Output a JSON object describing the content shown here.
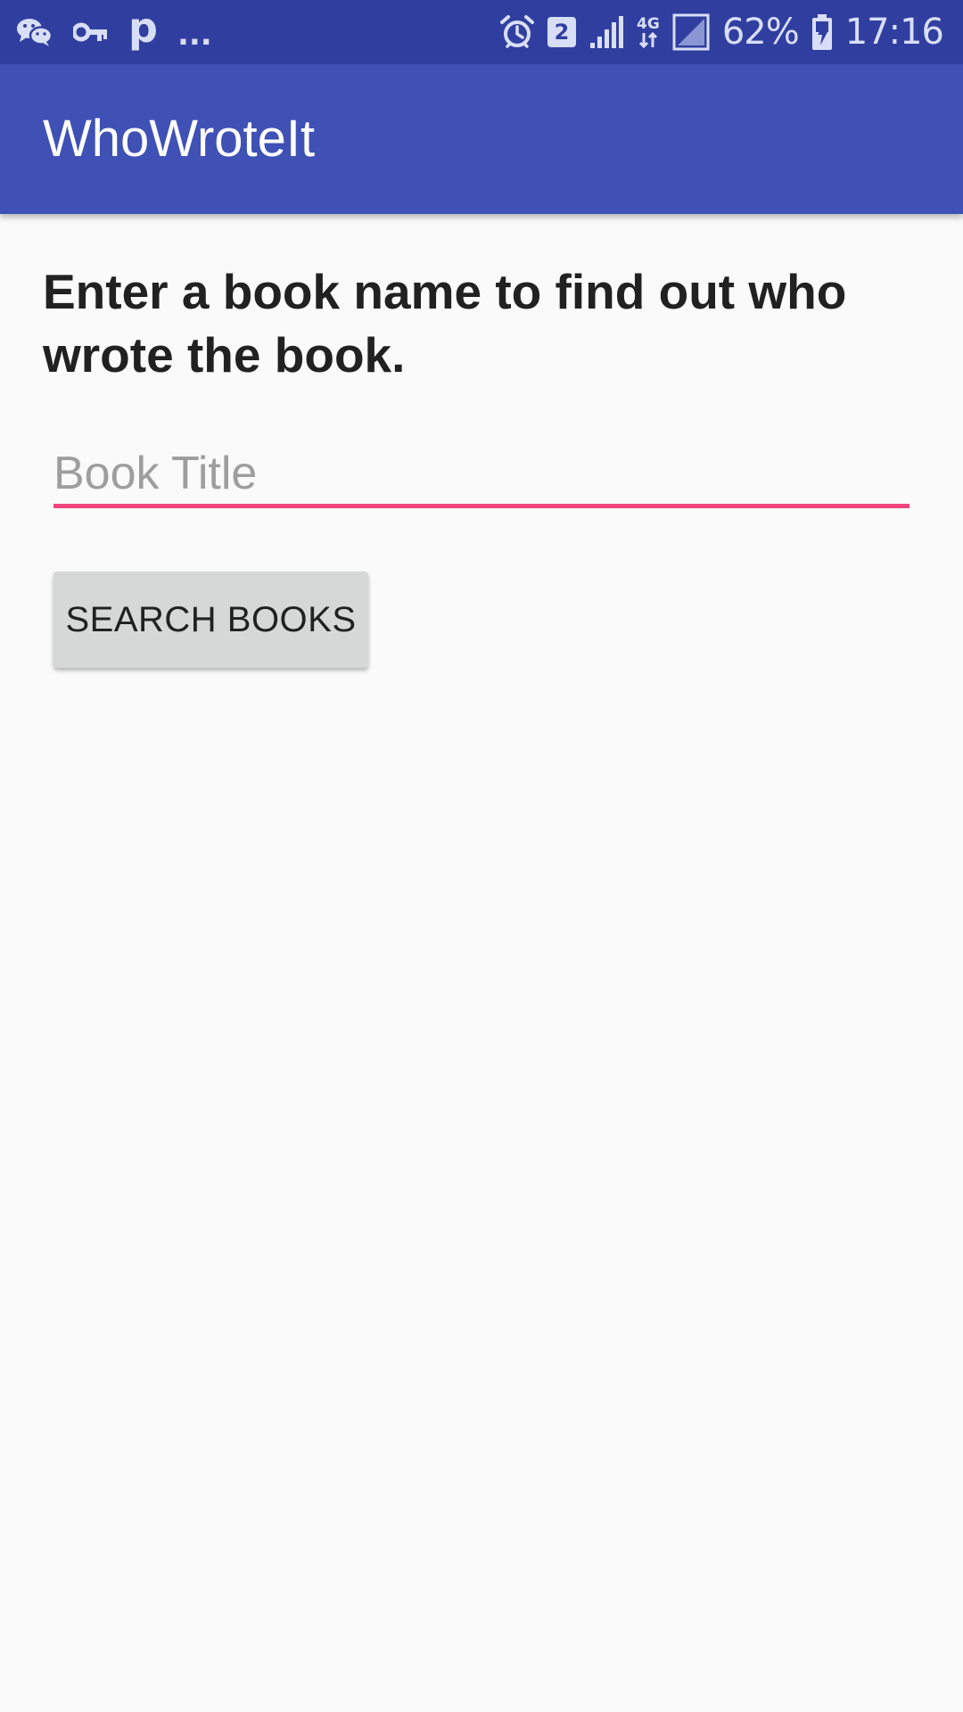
{
  "status_bar": {
    "left_icons": [
      "wechat-icon",
      "vpn-key-icon",
      "p-notification-icon"
    ],
    "p_glyph": "p",
    "more_indicator": "...",
    "right_icons": [
      "alarm-icon",
      "sim-2-icon",
      "signal-icon",
      "network-4g-icon",
      "signal-empty-icon",
      "battery-charging-icon"
    ],
    "sim_number": "2",
    "network_type": "4G",
    "battery_percent": "62%",
    "time": "17:16"
  },
  "app_bar": {
    "title": "WhoWroteIt"
  },
  "main": {
    "instructions": "Enter a book name to find out who wrote the book.",
    "book_input": {
      "placeholder": "Book Title",
      "value": ""
    },
    "search_button_label": "SEARCH BOOKS"
  },
  "colors": {
    "status_bar": "#303f9f",
    "app_bar": "#3f51b5",
    "accent": "#f0457c",
    "background": "#fafafa",
    "button": "#d6d7d7",
    "text_primary": "#212121",
    "hint": "#9e9e9e"
  }
}
